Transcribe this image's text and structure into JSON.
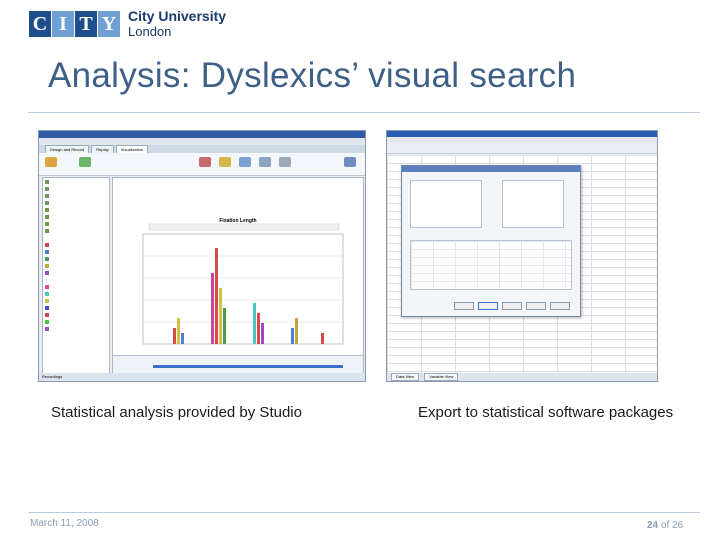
{
  "logo": {
    "letters": [
      "C",
      "I",
      "T",
      "Y"
    ],
    "line1": "City University",
    "line2": "London"
  },
  "slide": {
    "title": "Analysis: Dyslexics’ visual search"
  },
  "captions": {
    "left": "Statistical analysis provided by Studio",
    "right": "Export to statistical software packages"
  },
  "footer": {
    "date": "March 11, 2008",
    "page_current": "24",
    "page_rest": "of 26"
  },
  "screenshot_left": {
    "tabs": [
      "Design and Record",
      "Replay",
      "Visualization"
    ],
    "chart_title": "Fixation Length",
    "status": "Recordings"
  },
  "screenshot_right": {
    "tabs": [
      "Data View",
      "Variable View"
    ]
  },
  "colors": {
    "title": "#3e5f86",
    "logo_dark": "#1f4e8c",
    "logo_light": "#6ea0d4",
    "footer": "#8a9db8"
  }
}
